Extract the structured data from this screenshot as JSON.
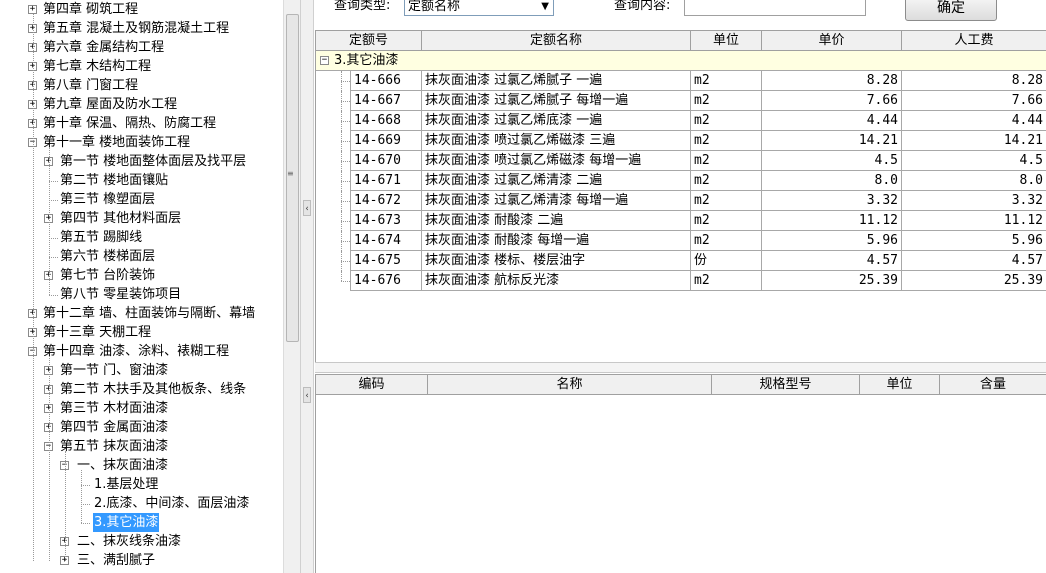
{
  "query": {
    "type_label": "查询类型:",
    "type_value": "定额名称",
    "content_label": "查询内容:",
    "content_value": "",
    "confirm_label": "确定"
  },
  "tree": [
    {
      "label": "第四章  砌筑工程",
      "level": 0,
      "expander": "+"
    },
    {
      "label": "第五章  混凝土及钢筋混凝土工程",
      "level": 0,
      "expander": "+"
    },
    {
      "label": "第六章  金属结构工程",
      "level": 0,
      "expander": "+"
    },
    {
      "label": "第七章  木结构工程",
      "level": 0,
      "expander": "+"
    },
    {
      "label": "第八章  门窗工程",
      "level": 0,
      "expander": "+"
    },
    {
      "label": "第九章  屋面及防水工程",
      "level": 0,
      "expander": "+"
    },
    {
      "label": "第十章  保温、隔热、防腐工程",
      "level": 0,
      "expander": "+"
    },
    {
      "label": "第十一章  楼地面装饰工程",
      "level": 0,
      "expander": "-"
    },
    {
      "label": "第一节  楼地面整体面层及找平层",
      "level": 1,
      "expander": "+"
    },
    {
      "label": "第二节  楼地面镶贴",
      "level": 1,
      "expander": ""
    },
    {
      "label": "第三节  橡塑面层",
      "level": 1,
      "expander": ""
    },
    {
      "label": "第四节  其他材料面层",
      "level": 1,
      "expander": "+"
    },
    {
      "label": "第五节  踢脚线",
      "level": 1,
      "expander": ""
    },
    {
      "label": "第六节  楼梯面层",
      "level": 1,
      "expander": ""
    },
    {
      "label": "第七节  台阶装饰",
      "level": 1,
      "expander": "+"
    },
    {
      "label": "第八节  零星装饰项目",
      "level": 1,
      "expander": ""
    },
    {
      "label": "第十二章  墙、柱面装饰与隔断、幕墙",
      "level": 0,
      "expander": "+"
    },
    {
      "label": "第十三章  天棚工程",
      "level": 0,
      "expander": "+"
    },
    {
      "label": "第十四章  油漆、涂料、裱糊工程",
      "level": 0,
      "expander": "-"
    },
    {
      "label": "第一节  门、窗油漆",
      "level": 1,
      "expander": "+"
    },
    {
      "label": "第二节  木扶手及其他板条、线条",
      "level": 1,
      "expander": "+"
    },
    {
      "label": "第三节  木材面油漆",
      "level": 1,
      "expander": "+"
    },
    {
      "label": "第四节  金属面油漆",
      "level": 1,
      "expander": "+"
    },
    {
      "label": "第五节  抹灰面油漆",
      "level": 1,
      "expander": "-"
    },
    {
      "label": "一、抹灰面油漆",
      "level": 2,
      "expander": "-"
    },
    {
      "label": "1.基层处理",
      "level": 3,
      "expander": ""
    },
    {
      "label": "2.底漆、中间漆、面层油漆",
      "level": 3,
      "expander": ""
    },
    {
      "label": "3.其它油漆",
      "level": 3,
      "expander": "",
      "selected": true
    },
    {
      "label": "二、抹灰线条油漆",
      "level": 2,
      "expander": "+"
    },
    {
      "label": "三、满刮腻子",
      "level": 2,
      "expander": "+"
    }
  ],
  "main_table": {
    "headers": [
      "定额号",
      "定额名称",
      "单位",
      "单价",
      "人工费"
    ],
    "group_label": "3.其它油漆",
    "rows": [
      {
        "code": "14-666",
        "name": "抹灰面油漆 过氯乙烯腻子 一遍",
        "unit": "m2",
        "price": "8.28",
        "labor": "8.28"
      },
      {
        "code": "14-667",
        "name": "抹灰面油漆 过氯乙烯腻子 每增一遍",
        "unit": "m2",
        "price": "7.66",
        "labor": "7.66"
      },
      {
        "code": "14-668",
        "name": "抹灰面油漆 过氯乙烯底漆 一遍",
        "unit": "m2",
        "price": "4.44",
        "labor": "4.44"
      },
      {
        "code": "14-669",
        "name": "抹灰面油漆 喷过氯乙烯磁漆 三遍",
        "unit": "m2",
        "price": "14.21",
        "labor": "14.21"
      },
      {
        "code": "14-670",
        "name": "抹灰面油漆 喷过氯乙烯磁漆 每增一遍",
        "unit": "m2",
        "price": "4.5",
        "labor": "4.5"
      },
      {
        "code": "14-671",
        "name": "抹灰面油漆 过氯乙烯清漆 二遍",
        "unit": "m2",
        "price": "8.0",
        "labor": "8.0"
      },
      {
        "code": "14-672",
        "name": "抹灰面油漆 过氯乙烯清漆 每增一遍",
        "unit": "m2",
        "price": "3.32",
        "labor": "3.32"
      },
      {
        "code": "14-673",
        "name": "抹灰面油漆 耐酸漆 二遍",
        "unit": "m2",
        "price": "11.12",
        "labor": "11.12"
      },
      {
        "code": "14-674",
        "name": "抹灰面油漆 耐酸漆 每增一遍",
        "unit": "m2",
        "price": "5.96",
        "labor": "5.96"
      },
      {
        "code": "14-675",
        "name": "抹灰面油漆 楼标、楼层油字",
        "unit": "份",
        "price": "4.57",
        "labor": "4.57"
      },
      {
        "code": "14-676",
        "name": "抹灰面油漆 航标反光漆",
        "unit": "m2",
        "price": "25.39",
        "labor": "25.39"
      }
    ]
  },
  "detail_table": {
    "headers": [
      "编码",
      "名称",
      "规格型号",
      "单位",
      "含量"
    ]
  },
  "colors": {
    "selection": "#3399ff",
    "group_row_bg": "#ffffe1",
    "header_bg": "#f0f0f0"
  }
}
